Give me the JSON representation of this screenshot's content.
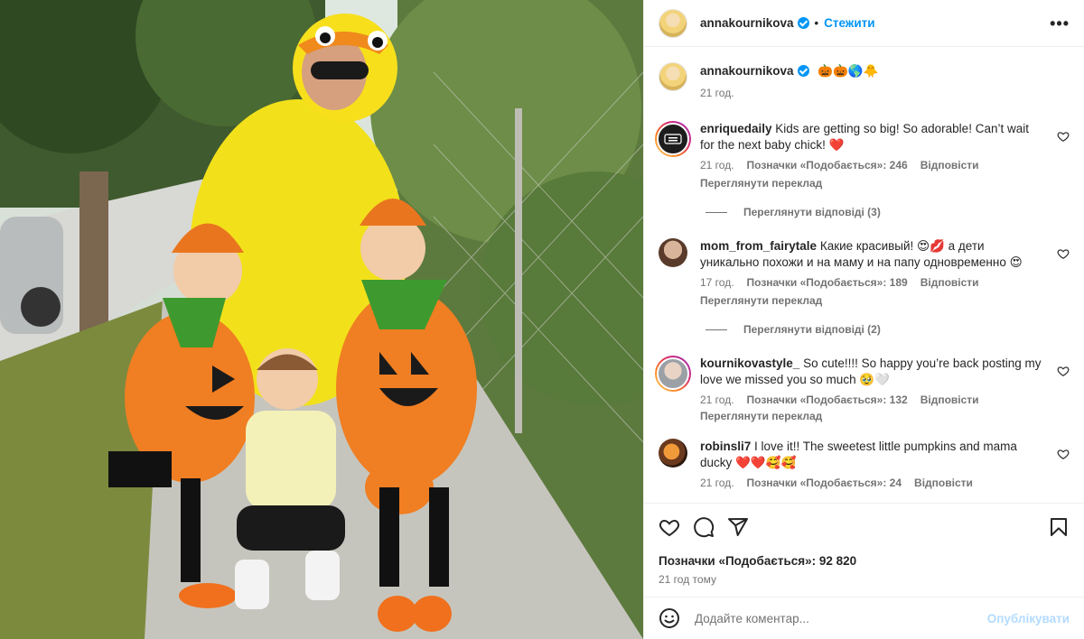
{
  "post": {
    "author": "annakournikova",
    "follow_label": "Стежити",
    "more_label": "•••",
    "dot": "•"
  },
  "caption": {
    "username": "annakournikova",
    "emoji": "🎃🎃🌎🐥",
    "time": "21 год."
  },
  "comments": [
    {
      "username": "enriquedaily",
      "text": "Kids are getting so big! So adorable! Can’t wait for the next baby chick! ❤️",
      "time": "21 год.",
      "likes": "Позначки «Подобається»: 246",
      "reply": "Відповісти",
      "translate": "Переглянути переклад",
      "replies": "Переглянути відповіді (3)"
    },
    {
      "username": "mom_from_fairytale",
      "text": "Какие красивый! 😍💋 а дети уникально похожи и на маму и на папу одновременно 😍",
      "time": "17 год.",
      "likes": "Позначки «Подобається»: 189",
      "reply": "Відповісти",
      "translate": "Переглянути переклад",
      "replies": "Переглянути відповіді (2)"
    },
    {
      "username": "kournikovastyle_",
      "text": "So cute!!!! So happy you’re back posting my love we missed you so much 🥹🤍",
      "time": "21 год.",
      "likes": "Позначки «Подобається»: 132",
      "reply": "Відповісти",
      "translate": "Переглянути переклад"
    },
    {
      "username": "robinsli7",
      "text": "I love it!! The sweetest little pumpkins and mama ducky ❤️❤️🥰🥰",
      "time": "21 год.",
      "likes": "Позначки «Подобається»: 24",
      "reply": "Відповісти"
    }
  ],
  "stats": {
    "likes": "Позначки «Подобається»: 92 820",
    "time": "21 год тому"
  },
  "composer": {
    "placeholder": "Додайте коментар...",
    "publish": "Опублікувати"
  },
  "icons": [
    "heart-icon",
    "comment-icon",
    "share-icon",
    "bookmark-icon",
    "emoji-icon",
    "verified-icon",
    "more-icon"
  ],
  "colors": {
    "accent": "#0095f6",
    "text": "#262626",
    "muted": "#737373",
    "like_heart": "#ff3040"
  }
}
